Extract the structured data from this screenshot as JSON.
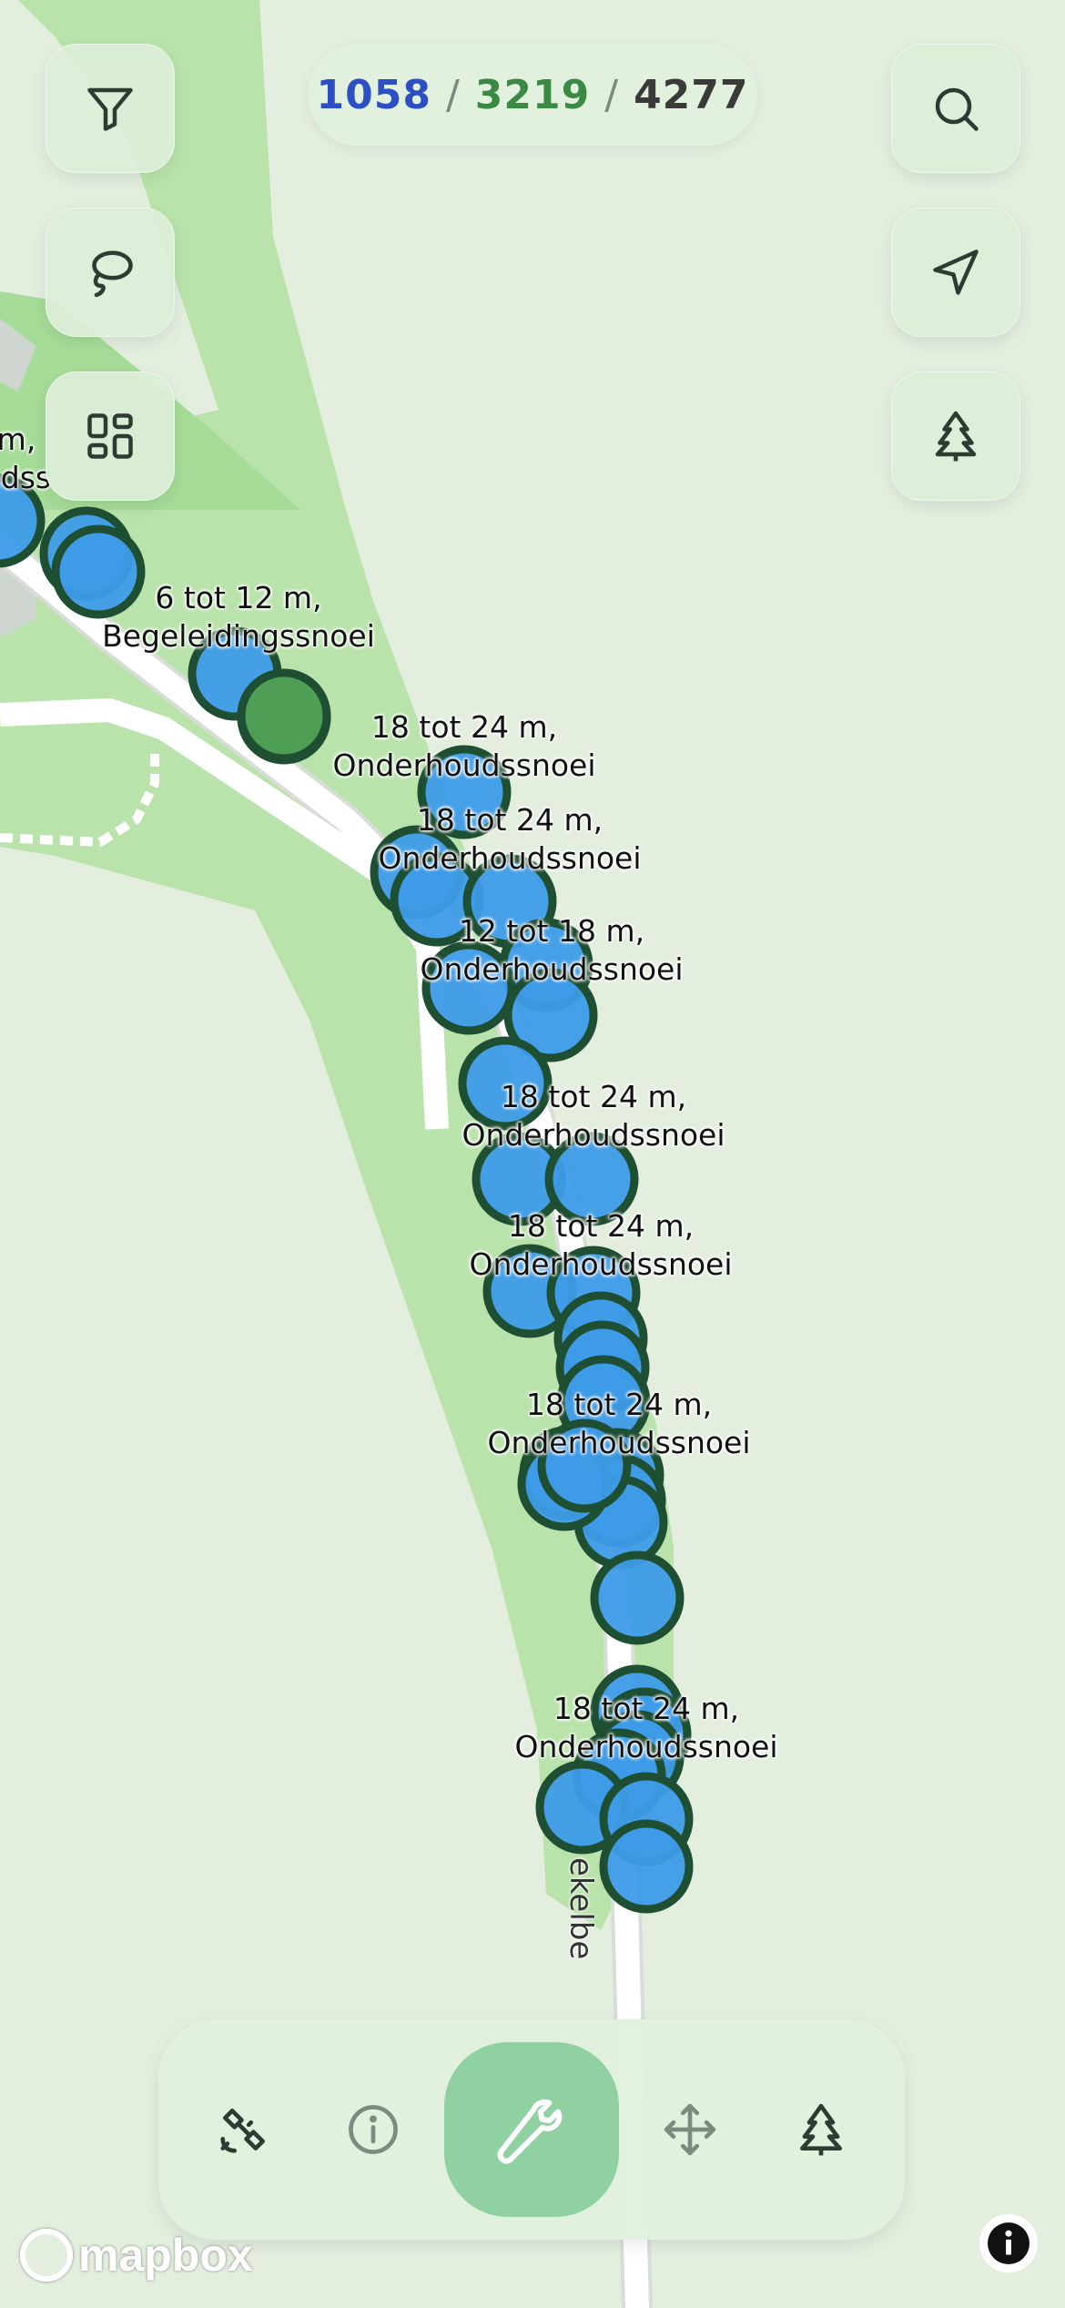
{
  "counter": {
    "selected": "1058",
    "visible": "3219",
    "total": "4277",
    "separator": "/",
    "colors": {
      "selected": "#2d4fc6",
      "visible": "#3a8a45",
      "total": "#3a3a3a"
    }
  },
  "map": {
    "street_label": "ekelbe",
    "tree_labels": [
      {
        "line1": "m,",
        "line2": "udss"
      },
      {
        "line1": "6 tot 12 m,",
        "line2": "Begeleidingssnoei"
      },
      {
        "line1": "18 tot 24 m,",
        "line2": "Onderhoudssnoei"
      },
      {
        "line1": "18 tot 24 m,",
        "line2": "Onderhoudssnoei"
      },
      {
        "line1": "12 tot 18 m,",
        "line2": "Onderhoudssnoei"
      },
      {
        "line1": "18 tot 24 m,",
        "line2": "Onderhoudssnoei"
      },
      {
        "line1": "18 tot 24 m,",
        "line2": "Onderhoudssnoei"
      },
      {
        "line1": "18 tot 24 m,",
        "line2": "Onderhoudssnoei"
      },
      {
        "line1": "18 tot 24 m,",
        "line2": "Onderhoudssnoei"
      }
    ],
    "colors": {
      "tree_fill": "#3d9be8",
      "tree_stroke": "#1f4f33",
      "tree_green": "#4e9e55",
      "park": "#b5e2a6",
      "road": "#ffffff"
    }
  },
  "left_buttons": {
    "filter": "filter-icon",
    "lasso": "lasso-icon",
    "layers": "layout-grid-icon"
  },
  "right_buttons": {
    "search": "search-icon",
    "locate": "navigation-icon",
    "tree": "tree-icon"
  },
  "toolbar": {
    "items": [
      "satellite-icon",
      "info-icon",
      "wrench-icon",
      "move-icon",
      "tree-icon"
    ],
    "active": "wrench-icon",
    "active_color": "#8fd1a0"
  },
  "footer": {
    "logo_text": "mapbox",
    "attribution_icon": "info-icon"
  }
}
